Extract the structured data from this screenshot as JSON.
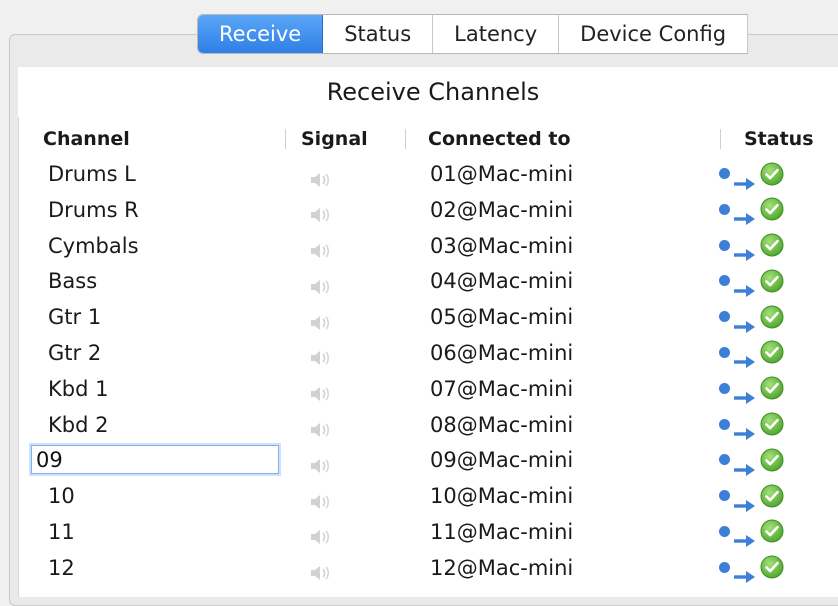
{
  "tabs": [
    {
      "label": "Receive",
      "active": true
    },
    {
      "label": "Status",
      "active": false
    },
    {
      "label": "Latency",
      "active": false
    },
    {
      "label": "Device Config",
      "active": false
    }
  ],
  "section_title": "Receive Channels",
  "columns": {
    "channel": "Channel",
    "signal": "Signal",
    "connected_to": "Connected to",
    "status": "Status"
  },
  "rows": [
    {
      "channel": "Drums L",
      "connected_to": "01@Mac-mini"
    },
    {
      "channel": "Drums R",
      "connected_to": "02@Mac-mini"
    },
    {
      "channel": "Cymbals",
      "connected_to": "03@Mac-mini"
    },
    {
      "channel": "Bass",
      "connected_to": "04@Mac-mini"
    },
    {
      "channel": "Gtr 1",
      "connected_to": "05@Mac-mini"
    },
    {
      "channel": "Gtr 2",
      "connected_to": "06@Mac-mini"
    },
    {
      "channel": "Kbd 1",
      "connected_to": "07@Mac-mini"
    },
    {
      "channel": "Kbd 2",
      "connected_to": "08@Mac-mini"
    },
    {
      "channel": "09",
      "connected_to": "09@Mac-mini",
      "editing": true
    },
    {
      "channel": "10",
      "connected_to": "10@Mac-mini"
    },
    {
      "channel": "11",
      "connected_to": "11@Mac-mini"
    },
    {
      "channel": "12",
      "connected_to": "12@Mac-mini"
    }
  ],
  "icons": {
    "signal": "speaker-icon",
    "status_flow": "dot-arrow-icon",
    "status_ok": "check-circle-icon"
  },
  "colors": {
    "active_tab": "#2f7fe6",
    "status_blue": "#3c7fd6",
    "status_green": "#55b535"
  }
}
